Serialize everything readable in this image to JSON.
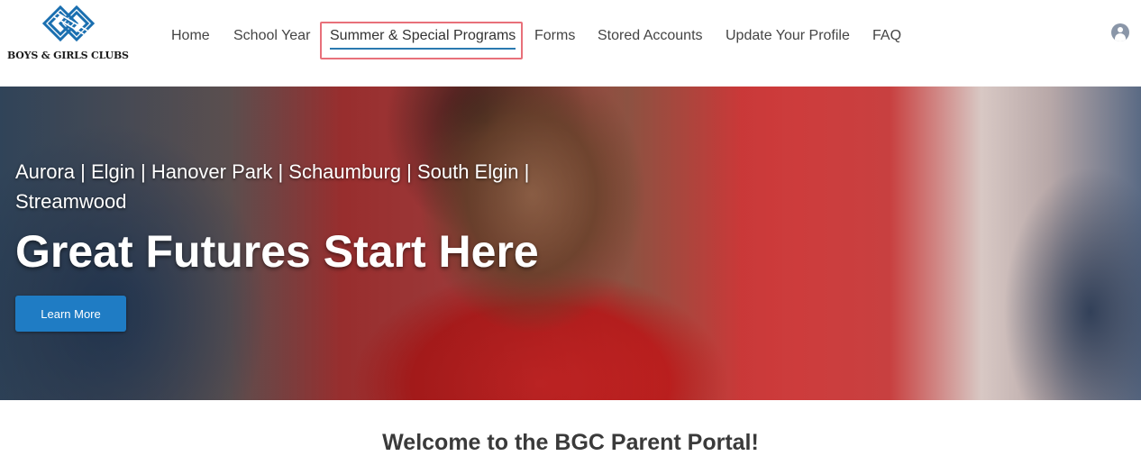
{
  "brand": {
    "name": "BOYS & GIRLS CLUBS",
    "logo_color": "#1a6fb0"
  },
  "nav": {
    "items": [
      {
        "label": "Home"
      },
      {
        "label": "School Year"
      },
      {
        "label": "Summer & Special Programs",
        "active": true
      },
      {
        "label": "Forms"
      },
      {
        "label": "Stored Accounts"
      },
      {
        "label": "Update Your Profile"
      },
      {
        "label": "FAQ"
      }
    ],
    "accent": "#2a7ab0",
    "highlight_color": "#e8707a"
  },
  "user": {
    "icon": "user-avatar-icon"
  },
  "hero": {
    "locations": "Aurora | Elgin | Hanover Park | Schaumburg | South Elgin | Streamwood",
    "title": "Great Futures Start Here",
    "button_label": "Learn More",
    "button_color": "#1f7cc4"
  },
  "welcome": {
    "heading": "Welcome to the BGC Parent Portal!"
  }
}
